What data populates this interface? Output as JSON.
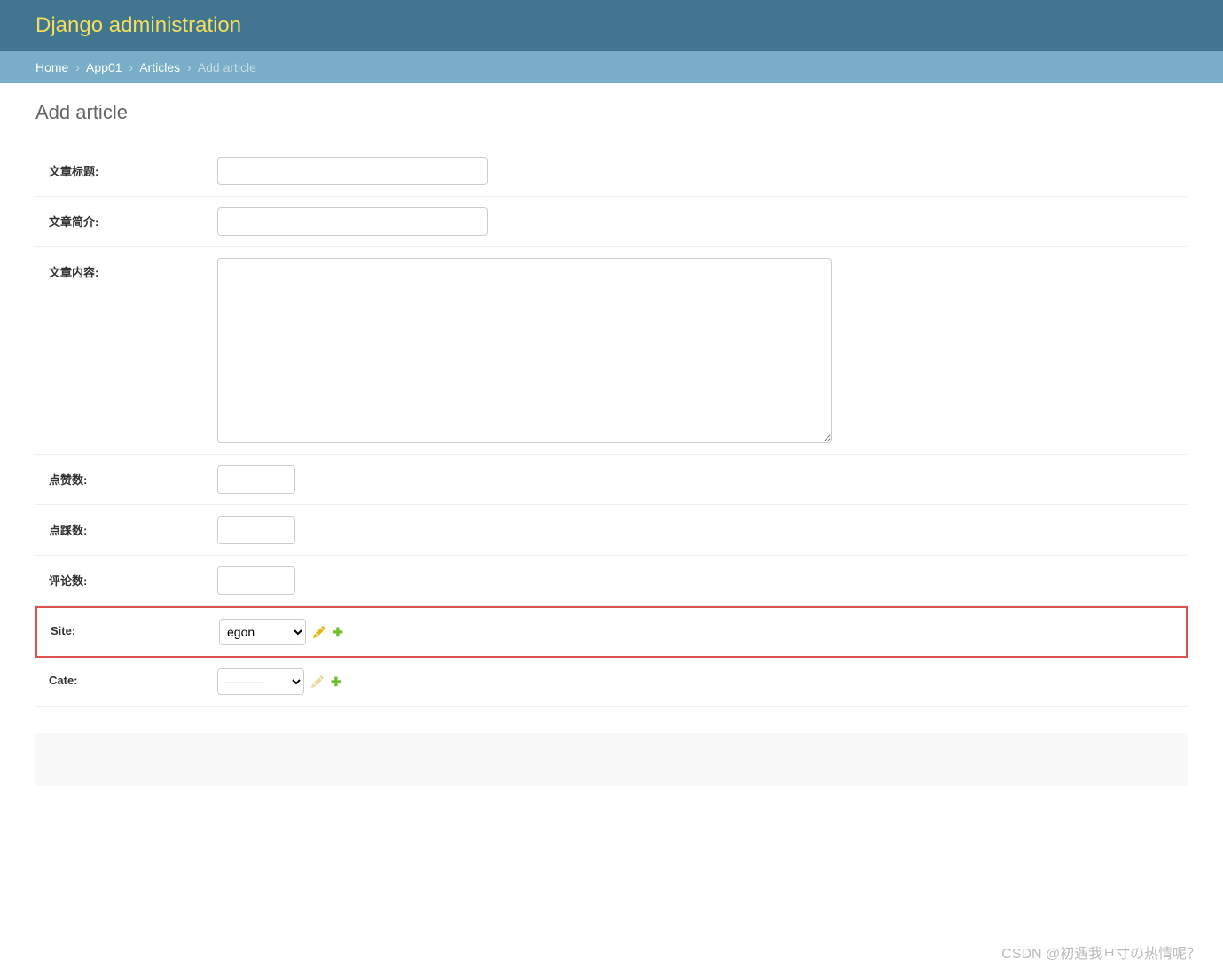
{
  "header": {
    "title": "Django administration"
  },
  "breadcrumbs": {
    "home": "Home",
    "app": "App01",
    "model": "Articles",
    "current": "Add article"
  },
  "page_title": "Add article",
  "fields": {
    "title": {
      "label": "文章标题:",
      "value": ""
    },
    "desc": {
      "label": "文章简介:",
      "value": ""
    },
    "content": {
      "label": "文章内容:",
      "value": ""
    },
    "up_num": {
      "label": "点赞数:",
      "value": ""
    },
    "down_num": {
      "label": "点踩数:",
      "value": ""
    },
    "comment_num": {
      "label": "评论数:",
      "value": ""
    },
    "site": {
      "label": "Site:",
      "selected": "egon"
    },
    "cate": {
      "label": "Cate:",
      "selected": "---------"
    }
  },
  "watermark": "CSDN @初遇我ㅂ寸の热情呢？"
}
